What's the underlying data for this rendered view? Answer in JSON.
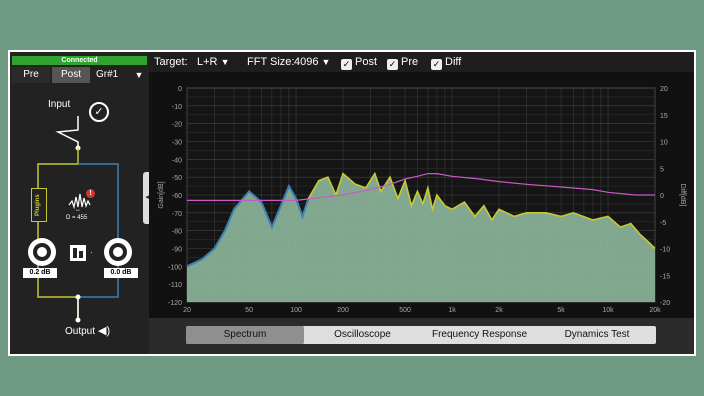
{
  "left_panel": {
    "status": "Connected",
    "mode_buttons": {
      "pre": "Pre",
      "post": "Post",
      "group": "Gr#1"
    },
    "input_label": "Input",
    "output_label": "Output",
    "plugins_label": "Plugins",
    "delay_label": "D = 455",
    "knob_left_value": "0.2 dB",
    "knob_right_value": "0.0 dB"
  },
  "toolbar": {
    "target_label": "Target:",
    "target_value": "L+R",
    "fft_label": "FFT Size:",
    "fft_value": "4096",
    "post_label": "Post",
    "pre_label": "Pre",
    "diff_label": "Diff"
  },
  "tabs": [
    "Spectrum",
    "Oscilloscope",
    "Frequency Response",
    "Dynamics Test"
  ],
  "colors": {
    "fill": "#8db89c",
    "yellow": "#c8c832",
    "blue": "#3b7fb4",
    "magenta": "#c85ac8",
    "status": "#2fa52f"
  },
  "chart_data": {
    "type": "area",
    "xscale": "log",
    "xlim": [
      20,
      20000
    ],
    "ylim": [
      -120,
      0
    ],
    "y2lim": [
      -20,
      20
    ],
    "ylabel": "Gain[dB]",
    "y2label": "Diff[dB]",
    "xticks": [
      "20",
      "50",
      "100",
      "200",
      "500",
      "1k",
      "2k",
      "5k",
      "10k",
      "20k"
    ],
    "xtick_values": [
      20,
      50,
      100,
      200,
      500,
      1000,
      2000,
      5000,
      10000,
      20000
    ],
    "yticks": [
      "0",
      "-10",
      "-20",
      "-30",
      "-40",
      "-50",
      "-60",
      "-70",
      "-80",
      "-90",
      "-100",
      "-110",
      "-120"
    ],
    "y2ticks": [
      "20",
      "15",
      "10",
      "5",
      "0",
      "-5",
      "-10",
      "-15",
      "-20"
    ],
    "spectrum": {
      "x": [
        20,
        25,
        30,
        35,
        40,
        50,
        60,
        70,
        80,
        90,
        100,
        110,
        120,
        140,
        160,
        180,
        200,
        240,
        280,
        320,
        350,
        400,
        450,
        500,
        550,
        600,
        650,
        700,
        750,
        800,
        900,
        1000,
        1200,
        1400,
        1600,
        1800,
        2000,
        2500,
        3000,
        4000,
        5000,
        6000,
        8000,
        10000,
        12000,
        14000,
        16000,
        18000,
        20000
      ],
      "y": [
        -100,
        -96,
        -90,
        -80,
        -68,
        -58,
        -64,
        -78,
        -66,
        -55,
        -62,
        -72,
        -62,
        -52,
        -50,
        -60,
        -48,
        -54,
        -56,
        -48,
        -58,
        -50,
        -62,
        -52,
        -66,
        -58,
        -65,
        -56,
        -68,
        -60,
        -66,
        -68,
        -64,
        -72,
        -66,
        -74,
        -68,
        -72,
        -70,
        -70,
        -72,
        -70,
        -74,
        -72,
        -78,
        -76,
        -82,
        -86,
        -90
      ]
    },
    "diff": {
      "x": [
        20,
        40,
        80,
        100,
        200,
        300,
        400,
        500,
        600,
        700,
        800,
        1000,
        1500,
        2000,
        3000,
        5000,
        8000,
        10000,
        15000,
        20000
      ],
      "y": [
        -1,
        -1,
        -1,
        -1,
        0,
        1,
        2,
        3,
        3.5,
        4,
        4,
        3.5,
        3,
        2.5,
        2,
        1.5,
        1,
        0.5,
        0,
        0
      ]
    }
  }
}
